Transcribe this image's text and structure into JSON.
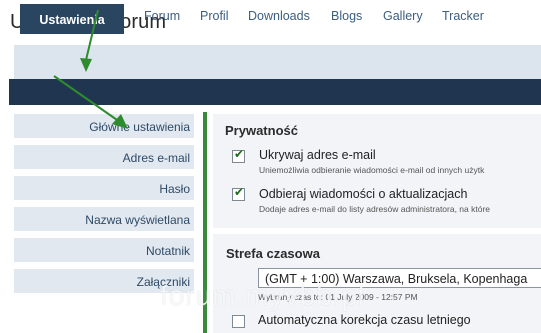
{
  "page_title": "Ustawienia forum",
  "tabs": [
    {
      "label": "Ustawienia",
      "active": true
    },
    {
      "label": "Forum"
    },
    {
      "label": "Profil"
    },
    {
      "label": "Downloads"
    },
    {
      "label": "Blogs"
    },
    {
      "label": "Gallery"
    },
    {
      "label": "Tracker"
    }
  ],
  "sidebar": {
    "items": [
      {
        "label": "Główne ustawienia"
      },
      {
        "label": "Adres e-mail"
      },
      {
        "label": "Hasło"
      },
      {
        "label": "Nazwa wyświetlana"
      },
      {
        "label": "Notatnik"
      },
      {
        "label": "Załączniki"
      }
    ]
  },
  "privacy": {
    "title": "Prywatność",
    "options": [
      {
        "label": "Ukrywaj adres e-mail",
        "description": "Uniemożliwia odbieranie wiadomości e-mail od innych użytk",
        "checked": true
      },
      {
        "label": "Odbieraj wiadomości o aktualizacjach",
        "description": "Dodaje adres e-mail do listy adresów administratora, na które",
        "checked": true
      }
    ]
  },
  "timezone": {
    "title": "Strefa czasowa",
    "selected": "(GMT + 1:00) Warszawa, Bruksela, Kopenhaga",
    "current_time": "Wybrany czas to: 01 July 2009 - 12:57 PM",
    "dst_label": "Automatyczna korekcja czasu letniego",
    "dst_checked": false
  },
  "watermark": "forum.myvbb.pl",
  "colors": {
    "tabbar": "#dce5ee",
    "active_tab": "#294560",
    "dark_band": "#203650",
    "annotation_arrow": "#2e8b2e"
  }
}
